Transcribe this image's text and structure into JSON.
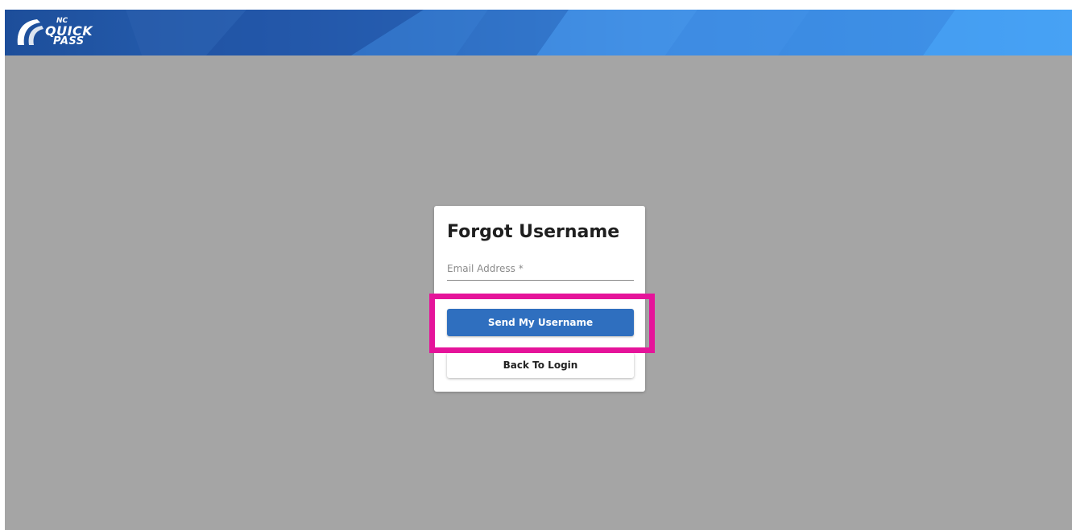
{
  "header": {
    "logo": {
      "line1": "NC",
      "line2": "QUICK",
      "line3": "PASS"
    }
  },
  "card": {
    "title": "Forgot Username",
    "email": {
      "placeholder": "Email Address *",
      "value": ""
    },
    "send_label": "Send My Username",
    "back_label": "Back To Login"
  },
  "colors": {
    "header_dark": "#1d4e9a",
    "header_light": "#45a0f4",
    "background": "#a5a5a5",
    "primary_button": "#2f6fbf",
    "highlight": "#e5149a"
  }
}
